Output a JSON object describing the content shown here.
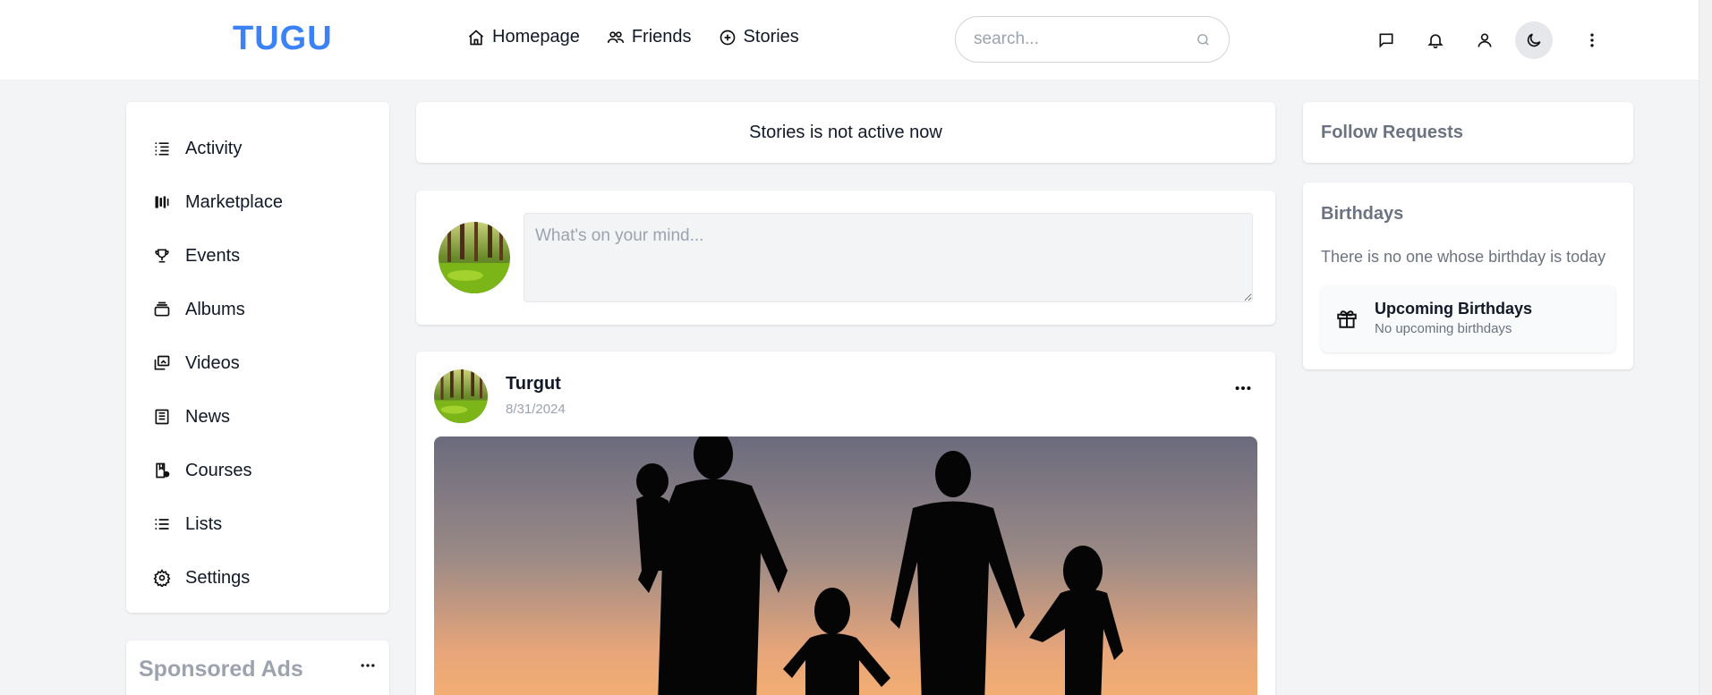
{
  "header": {
    "logo": "TUGU",
    "nav": [
      {
        "label": "Homepage",
        "icon": "home-icon"
      },
      {
        "label": "Friends",
        "icon": "friends-icon"
      },
      {
        "label": "Stories",
        "icon": "stories-icon"
      }
    ],
    "search_placeholder": "search...",
    "icons": [
      "chat-icon",
      "bell-icon",
      "user-icon",
      "moon-icon",
      "more-vertical-icon"
    ]
  },
  "sidebar": {
    "items": [
      {
        "label": "Activity",
        "icon": "activity-icon"
      },
      {
        "label": "Marketplace",
        "icon": "marketplace-icon"
      },
      {
        "label": "Events",
        "icon": "trophy-icon"
      },
      {
        "label": "Albums",
        "icon": "albums-icon"
      },
      {
        "label": "Videos",
        "icon": "videos-icon"
      },
      {
        "label": "News",
        "icon": "news-icon"
      },
      {
        "label": "Courses",
        "icon": "courses-icon"
      },
      {
        "label": "Lists",
        "icon": "list-icon"
      },
      {
        "label": "Settings",
        "icon": "gear-icon"
      }
    ],
    "ads_title": "Sponsored Ads"
  },
  "main": {
    "stories_status": "Stories is not active now",
    "composer_placeholder": "What's on your mind...",
    "post": {
      "author": "Turgut",
      "date": "8/31/2024"
    }
  },
  "right": {
    "follow_requests_title": "Follow Requests",
    "birthdays_title": "Birthdays",
    "birthdays_none": "There is no one whose birthday is today",
    "upcoming_title": "Upcoming Birthdays",
    "upcoming_sub": "No upcoming birthdays"
  },
  "colors": {
    "accent": "#3b82f6",
    "background": "#f3f4f6"
  }
}
